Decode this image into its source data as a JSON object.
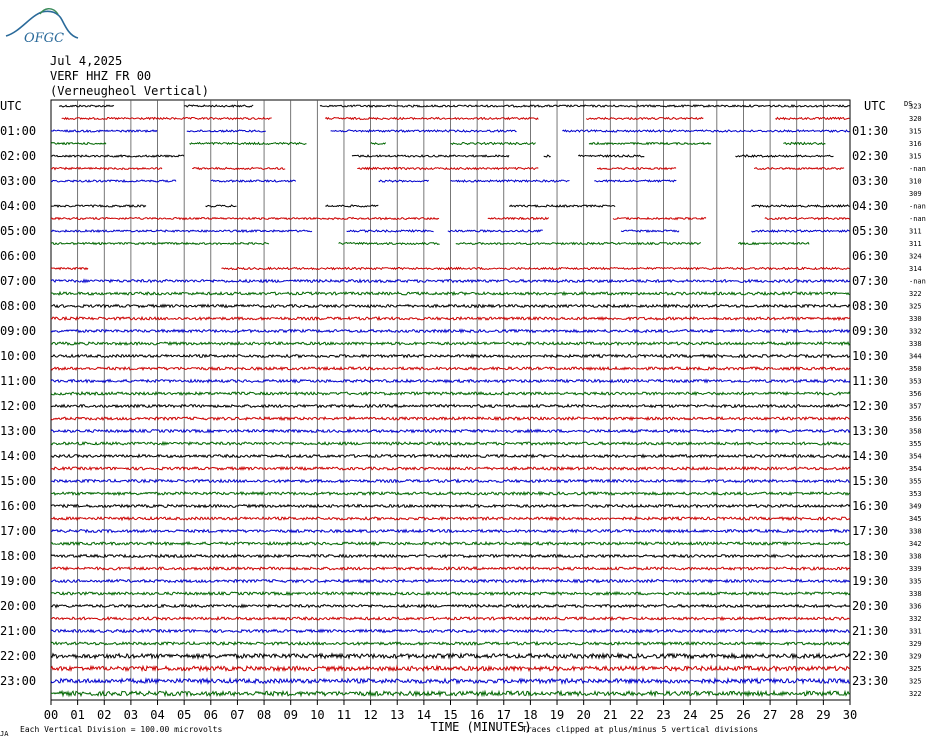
{
  "header": {
    "logo_text": "OFGC",
    "date": "Jul 4,2025",
    "station": "VERF HHZ FR 00",
    "description": "(Verneugheol Vertical)"
  },
  "colors": {
    "black": "#000000",
    "red": "#cc0000",
    "blue": "#0000cc",
    "green": "#006600",
    "logo": "#2a6a9a"
  },
  "chart_data": {
    "type": "line",
    "title": "",
    "xlabel": "TIME (MINUTES)",
    "ylabel": "",
    "xlim": [
      0,
      30
    ],
    "x_ticks": [
      "00",
      "01",
      "02",
      "03",
      "04",
      "05",
      "06",
      "07",
      "08",
      "09",
      "10",
      "11",
      "12",
      "13",
      "14",
      "15",
      "16",
      "17",
      "18",
      "19",
      "20",
      "21",
      "22",
      "23",
      "24",
      "25",
      "26",
      "27",
      "28",
      "29",
      "30"
    ],
    "left_axis_title": "UTC",
    "right_axis_title": "UTC",
    "ds_label": "DS",
    "left_labels": [
      "",
      "01:00",
      "02:00",
      "03:00",
      "04:00",
      "05:00",
      "06:00",
      "07:00",
      "08:00",
      "09:00",
      "10:00",
      "11:00",
      "12:00",
      "13:00",
      "14:00",
      "15:00",
      "16:00",
      "17:00",
      "18:00",
      "19:00",
      "20:00",
      "21:00",
      "22:00",
      "23:00"
    ],
    "right_labels": [
      "",
      "01:30",
      "02:30",
      "03:30",
      "04:30",
      "05:30",
      "06:30",
      "07:30",
      "08:30",
      "09:30",
      "10:30",
      "11:30",
      "12:30",
      "13:30",
      "14:30",
      "15:30",
      "16:30",
      "17:30",
      "18:30",
      "19:30",
      "20:30",
      "21:30",
      "22:30",
      "23:30"
    ],
    "ds_values": [
      "323",
      "320",
      "315",
      "316",
      "315",
      "-nan",
      "310",
      "309",
      "-nan",
      "-nan",
      "311",
      "311",
      "324",
      "314",
      "-nan",
      "322",
      "325",
      "330",
      "332",
      "338",
      "344",
      "350",
      "353",
      "356",
      "357",
      "356",
      "358",
      "355",
      "354",
      "354",
      "355",
      "353",
      "349",
      "345",
      "338",
      "342",
      "338",
      "339",
      "335",
      "338",
      "336",
      "332",
      "331",
      "329",
      "329",
      "325",
      "325",
      "322"
    ],
    "trace_colors": [
      "black",
      "red",
      "blue",
      "green"
    ],
    "traces_minutes_per_line": 30,
    "trace_segments": [
      [
        [
          0.3,
          2.4
        ],
        [
          5.0,
          7.6
        ],
        [
          10.1,
          30.0
        ]
      ],
      [
        [
          0.4,
          8.3
        ],
        [
          10.3,
          18.3
        ],
        [
          20.1,
          24.5
        ],
        [
          27.2,
          30.0
        ]
      ],
      [
        [
          0,
          4.0
        ],
        [
          5.1,
          8.1
        ],
        [
          10.5,
          17.5
        ],
        [
          19.2,
          30.0
        ]
      ],
      [
        [
          0,
          2.1
        ],
        [
          5.2,
          9.6
        ],
        [
          12.0,
          12.6
        ],
        [
          15.0,
          18.2
        ],
        [
          20.2,
          24.8
        ],
        [
          27.5,
          29.1
        ]
      ],
      [
        [
          0,
          5.0
        ],
        [
          11.3,
          17.2
        ],
        [
          18.5,
          18.8
        ],
        [
          19.8,
          22.3
        ],
        [
          25.7,
          29.4
        ]
      ],
      [
        [
          0,
          4.2
        ],
        [
          5.3,
          8.8
        ],
        [
          11.5,
          18.3
        ],
        [
          20.5,
          23.5
        ],
        [
          26.4,
          29.8
        ]
      ],
      [
        [
          0,
          4.7
        ],
        [
          6.0,
          9.2
        ],
        [
          12.3,
          14.2
        ],
        [
          15.0,
          19.5
        ],
        [
          20.4,
          23.5
        ]
      ],
      [
        [],
        [
          0,
          0
        ]
      ],
      [
        [
          0,
          3.6
        ],
        [
          5.8,
          7.0
        ],
        [
          10.3,
          12.3
        ],
        [
          17.2,
          21.2
        ],
        [
          26.3,
          30.0
        ]
      ],
      [
        [
          0,
          14.6
        ],
        [
          16.4,
          18.7
        ],
        [
          21.1,
          24.6
        ],
        [
          26.8,
          30.0
        ]
      ],
      [
        [
          0,
          9.8
        ],
        [
          11.1,
          14.4
        ],
        [
          14.9,
          18.5
        ],
        [
          21.4,
          23.6
        ],
        [
          26.3,
          30.0
        ]
      ],
      [
        [
          0,
          8.2
        ],
        [
          10.8,
          14.6
        ],
        [
          15.2,
          24.4
        ],
        [
          25.8,
          28.5
        ]
      ],
      [],
      [
        [
          0,
          1.4
        ],
        [
          6.4,
          30.0
        ]
      ]
    ],
    "notes_left": "Each Vertical Division =  100.00 microvolts",
    "notes_right": "Traces clipped at plus/minus 5 vertical divisions",
    "corner_mark": "JA"
  }
}
